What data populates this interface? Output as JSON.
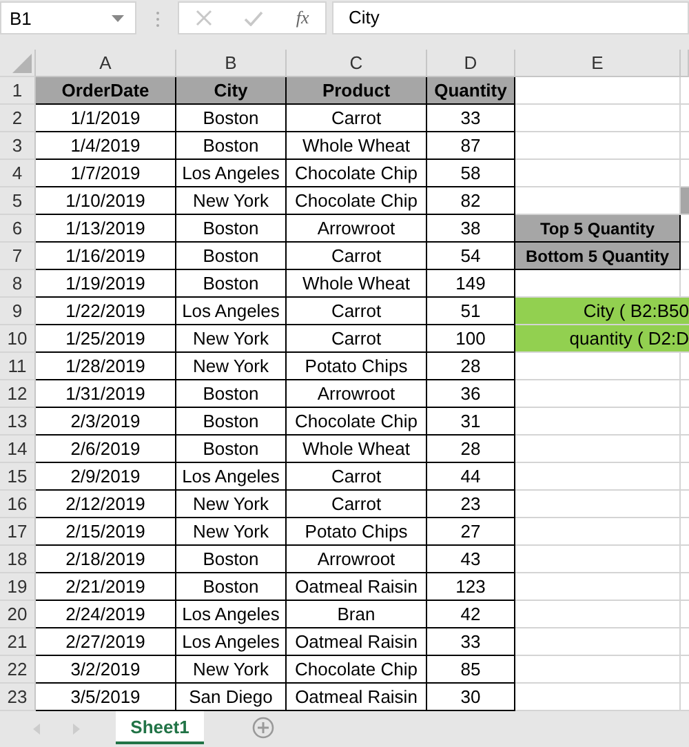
{
  "formula_bar": {
    "name_box": "B1",
    "function_label": "fx",
    "value": "City"
  },
  "column_headers": [
    "A",
    "B",
    "C",
    "D",
    "E"
  ],
  "header_row": {
    "number": "1",
    "cells": [
      "OrderDate",
      "City",
      "Product",
      "Quantity"
    ]
  },
  "rows": [
    {
      "number": "2",
      "date": "1/1/2019",
      "city": "Boston",
      "product": "Carrot",
      "quantity": "33"
    },
    {
      "number": "3",
      "date": "1/4/2019",
      "city": "Boston",
      "product": "Whole Wheat",
      "quantity": "87"
    },
    {
      "number": "4",
      "date": "1/7/2019",
      "city": "Los Angeles",
      "product": "Chocolate Chip",
      "quantity": "58"
    },
    {
      "number": "5",
      "date": "1/10/2019",
      "city": "New York",
      "product": "Chocolate Chip",
      "quantity": "82",
      "side": {
        "kind": "marker"
      }
    },
    {
      "number": "6",
      "date": "1/13/2019",
      "city": "Boston",
      "product": "Arrowroot",
      "quantity": "38",
      "side": {
        "kind": "gray",
        "text": "Top 5 Quantity"
      }
    },
    {
      "number": "7",
      "date": "1/16/2019",
      "city": "Boston",
      "product": "Carrot",
      "quantity": "54",
      "side": {
        "kind": "gray",
        "text": "Bottom 5 Quantity"
      }
    },
    {
      "number": "8",
      "date": "1/19/2019",
      "city": "Boston",
      "product": "Whole Wheat",
      "quantity": "149"
    },
    {
      "number": "9",
      "date": "1/22/2019",
      "city": "Los Angeles",
      "product": "Carrot",
      "quantity": "51",
      "side": {
        "kind": "green",
        "text": "City ( B2:B50"
      }
    },
    {
      "number": "10",
      "date": "1/25/2019",
      "city": "New York",
      "product": "Carrot",
      "quantity": "100",
      "side": {
        "kind": "green",
        "text": "quantity ( D2:D"
      }
    },
    {
      "number": "11",
      "date": "1/28/2019",
      "city": "New York",
      "product": "Potato Chips",
      "quantity": "28"
    },
    {
      "number": "12",
      "date": "1/31/2019",
      "city": "Boston",
      "product": "Arrowroot",
      "quantity": "36"
    },
    {
      "number": "13",
      "date": "2/3/2019",
      "city": "Boston",
      "product": "Chocolate Chip",
      "quantity": "31"
    },
    {
      "number": "14",
      "date": "2/6/2019",
      "city": "Boston",
      "product": "Whole Wheat",
      "quantity": "28"
    },
    {
      "number": "15",
      "date": "2/9/2019",
      "city": "Los Angeles",
      "product": "Carrot",
      "quantity": "44"
    },
    {
      "number": "16",
      "date": "2/12/2019",
      "city": "New York",
      "product": "Carrot",
      "quantity": "23"
    },
    {
      "number": "17",
      "date": "2/15/2019",
      "city": "New York",
      "product": "Potato Chips",
      "quantity": "27"
    },
    {
      "number": "18",
      "date": "2/18/2019",
      "city": "Boston",
      "product": "Arrowroot",
      "quantity": "43"
    },
    {
      "number": "19",
      "date": "2/21/2019",
      "city": "Boston",
      "product": "Oatmeal Raisin",
      "quantity": "123"
    },
    {
      "number": "20",
      "date": "2/24/2019",
      "city": "Los Angeles",
      "product": "Bran",
      "quantity": "42"
    },
    {
      "number": "21",
      "date": "2/27/2019",
      "city": "Los Angeles",
      "product": "Oatmeal Raisin",
      "quantity": "33"
    },
    {
      "number": "22",
      "date": "3/2/2019",
      "city": "New York",
      "product": "Chocolate Chip",
      "quantity": "85"
    },
    {
      "number": "23",
      "date": "3/5/2019",
      "city": "San Diego",
      "product": "Oatmeal Raisin",
      "quantity": "30"
    }
  ],
  "sheet_tabs": [
    {
      "label": "Sheet1",
      "selected": true
    }
  ]
}
